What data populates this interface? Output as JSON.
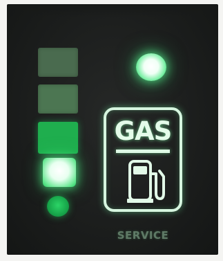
{
  "panel": {
    "level_indicator": {
      "segments": [
        {
          "position": "bottom-dot",
          "state": "on",
          "color": "#1fbf55"
        },
        {
          "position": "level-1",
          "state": "on-bright",
          "color": "#e9fff0"
        },
        {
          "position": "level-2",
          "state": "on",
          "color": "#1fae4e"
        },
        {
          "position": "level-3",
          "state": "off",
          "color": "#4c7652"
        },
        {
          "position": "level-4",
          "state": "off",
          "color": "#4a6b4f"
        }
      ]
    },
    "status_led": {
      "state": "on",
      "color": "#7ff0a8"
    },
    "gas_badge": {
      "text": "GAS",
      "icon": "fuel-pump-icon",
      "color": "#d6f5df"
    },
    "service_label": "SERVICE"
  }
}
